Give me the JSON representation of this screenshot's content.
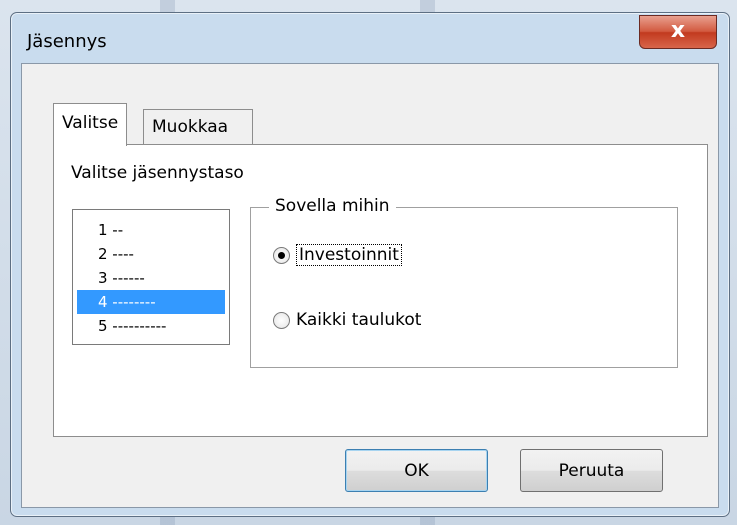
{
  "window": {
    "title": "Jäsennys",
    "close_label": "x"
  },
  "tabs": [
    {
      "label": "Valitse",
      "active": true
    },
    {
      "label": "Muokkaa",
      "active": false
    }
  ],
  "select_tab": {
    "level_label": "Valitse jäsennystaso",
    "levels": [
      "1 --",
      "2 ----",
      "3 ------",
      "4 --------",
      "5 ----------"
    ],
    "selected_level": "4 --------",
    "apply_group": {
      "legend": "Sovella mihin",
      "options": [
        {
          "label": "Investoinnit",
          "checked": true
        },
        {
          "label": "Kaikki taulukot",
          "checked": false
        }
      ]
    }
  },
  "buttons": {
    "ok_label": "OK",
    "cancel_label": "Peruuta"
  },
  "colors": {
    "selection": "#3399ff",
    "close_button": "#c8452b",
    "frame": "#c9dcee"
  }
}
